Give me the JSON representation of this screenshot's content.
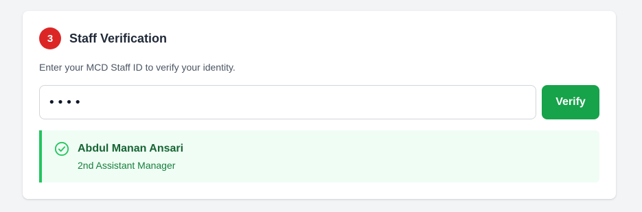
{
  "step": {
    "number": "3",
    "title": "Staff Verification",
    "description": "Enter your MCD Staff ID to verify your identity."
  },
  "staff_id_input": {
    "value": "••••",
    "type": "password"
  },
  "verify_button": {
    "label": "Verify"
  },
  "result": {
    "icon": "check-circle-icon",
    "name": "Abdul Manan Ansari",
    "role": "2nd Assistant Manager"
  },
  "colors": {
    "step_badge": "#dc2626",
    "verify_button": "#16a34a",
    "success_border": "#22c55e",
    "success_background": "#f0fdf4",
    "success_text": "#166534"
  }
}
